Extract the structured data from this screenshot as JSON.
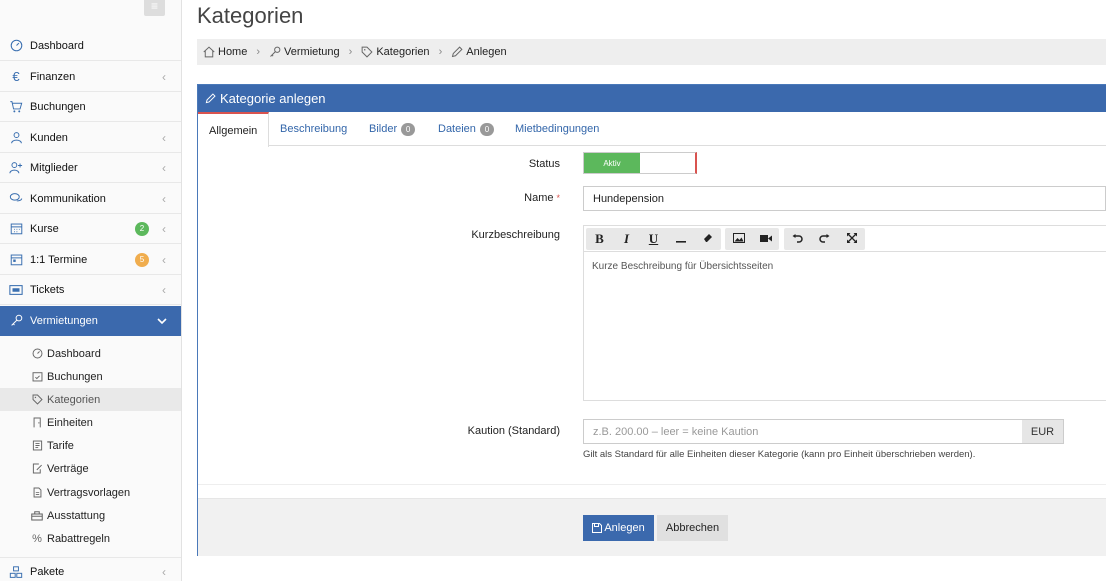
{
  "sidebar": {
    "items": [
      {
        "label": "Dashboard",
        "icon": "dashboard-icon"
      },
      {
        "label": "Finanzen",
        "icon": "euro-icon"
      },
      {
        "label": "Buchungen",
        "icon": "cart-icon"
      },
      {
        "label": "Kunden",
        "icon": "user-icon"
      },
      {
        "label": "Mitglieder",
        "icon": "user-plus-icon"
      },
      {
        "label": "Kommunikation",
        "icon": "chat-icon"
      },
      {
        "label": "Kurse",
        "icon": "calendar-icon",
        "badge": "2"
      },
      {
        "label": "1:1 Termine",
        "icon": "calendar-day-icon",
        "badge": "5"
      },
      {
        "label": "Tickets",
        "icon": "ticket-icon"
      },
      {
        "label": "Vermietungen",
        "icon": "key-icon"
      },
      {
        "label": "Pakete",
        "icon": "boxes-icon"
      }
    ],
    "sub_items": [
      {
        "label": "Dashboard",
        "icon": "dashboard-icon"
      },
      {
        "label": "Buchungen",
        "icon": "calendar-check-icon"
      },
      {
        "label": "Kategorien",
        "icon": "tag-icon"
      },
      {
        "label": "Einheiten",
        "icon": "door-icon"
      },
      {
        "label": "Tarife",
        "icon": "tariff-icon"
      },
      {
        "label": "Verträge",
        "icon": "contract-icon"
      },
      {
        "label": "Vertragsvorlagen",
        "icon": "file-icon"
      },
      {
        "label": "Ausstattung",
        "icon": "equipment-icon"
      },
      {
        "label": "Rabattregeln",
        "icon": "percent-icon"
      }
    ]
  },
  "colors": {
    "primary": "#3b69ad",
    "success": "#5cb85c",
    "warning": "#f0ad4e",
    "danger": "#d9534f"
  },
  "page": {
    "title": "Kategorien"
  },
  "breadcrumb": [
    {
      "label": "Home",
      "icon": "home-icon"
    },
    {
      "label": "Vermietung",
      "icon": "key-icon"
    },
    {
      "label": "Kategorien",
      "icon": "tag-icon"
    },
    {
      "label": "Anlegen",
      "icon": "pencil-icon"
    }
  ],
  "card": {
    "title": "Kategorie anlegen"
  },
  "tabs": [
    {
      "label": "Allgemein"
    },
    {
      "label": "Beschreibung"
    },
    {
      "label": "Bilder",
      "badge": "0"
    },
    {
      "label": "Dateien",
      "badge": "0"
    },
    {
      "label": "Mietbedingungen"
    }
  ],
  "form": {
    "status_label": "Status",
    "status_value": "Aktiv",
    "name_label": "Name",
    "name_required": "*",
    "name_value": "Hundepension",
    "short_desc_label": "Kurzbeschreibung",
    "short_desc_placeholder": "Kurze Beschreibung für Übersichtsseiten",
    "deposit_label": "Kaution (Standard)",
    "deposit_placeholder": "z.B. 200.00 – leer = keine Kaution",
    "deposit_unit": "EUR",
    "deposit_help": "Gilt als Standard für alle Einheiten dieser Kategorie (kann pro Einheit überschrieben werden)."
  },
  "footer": {
    "submit_label": "Anlegen",
    "cancel_label": "Abbrechen"
  }
}
